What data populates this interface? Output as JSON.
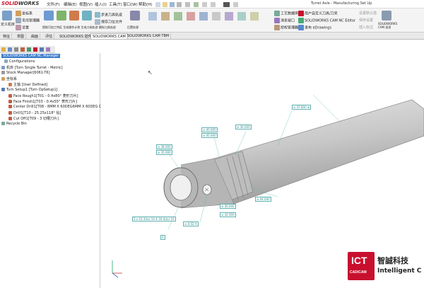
{
  "app": {
    "logo_main": "SOLID",
    "logo_sub": "WORKS",
    "document_title": "Turret Axle - Manufacturing Set Up"
  },
  "menus": [
    "文件(F)",
    "编辑(E)",
    "视图(V)",
    "插入(I)",
    "工具(T)",
    "窗口(W)",
    "帮助(H)"
  ],
  "ribbon": {
    "left": [
      "定义机床",
      "坐标系",
      "毛坯管理器",
      "设置"
    ],
    "middle": [
      "提取可加工特征",
      "生成操作计划",
      "生成刀具轨迹",
      "模拟刀具轨迹",
      "步进刀具轨迹",
      "保存刀位文件",
      "后置处理"
    ],
    "right": [
      "工艺数据库",
      "消息窗口",
      "授权管理器",
      "用户自定义刀具/刀夹",
      "SOLIDWORKS CAM NC Editor",
      "发布 eDrawings",
      "SOLIDWORKS CAM 选项",
      "设置默认值",
      "保存设置",
      "插入标注"
    ]
  },
  "tabs": [
    "特征",
    "草图",
    "曲面",
    "评估",
    "SOLIDWORKS 插件",
    "SOLIDWORKS CAM",
    "SOLIDWORKS CAM TBM"
  ],
  "active_tab": "SOLIDWORKS CAM",
  "tree": {
    "root": "SOLIDWORKS CAM NC Manager",
    "items": [
      "Configurations",
      "机床 [Turn Single Turret - Metric]",
      "Stock Manager[6061-T6]",
      "坐标系",
      "主轴 [User Defined]",
      "Turn Setup1 [Turn OpSetup1]",
      "Face Rough1[T01 - 0.4x80° 菱形刀片]",
      "Face Finish1[T03 - 0.4x55° 菱形刀片]",
      "Center Drill1[T08 - 8MM X 60DEG6MM X 60DEG CEN",
      "Drill1[T10 - 25.25x118° 钻]",
      "Cut Off1[T09 - 3 切槽刀片]",
      "Recycle Bin"
    ]
  },
  "annotations": [
    "⊘ 47.800 ⊕",
    "⊘ 40.000",
    "⊘ 45.000",
    "⊘ 38.000",
    "⊘ 35.000",
    "⊘ 36.000",
    "⊘ 30.000",
    "⊘ 44.000",
    "⊘ 42.000",
    "2 x 10.3(to) 10 X 16.4(to) 10",
    "⊘ 0.02 A",
    "A"
  ],
  "brand": {
    "logo_top": "ICT",
    "logo_bottom": "CAD/CAM",
    "name_cn": "智誠科技",
    "name_en": "Intelligent C"
  },
  "colors": {
    "accent": "#c8102e",
    "selection": "#3d7cc9",
    "part": "#c9c9c9"
  }
}
